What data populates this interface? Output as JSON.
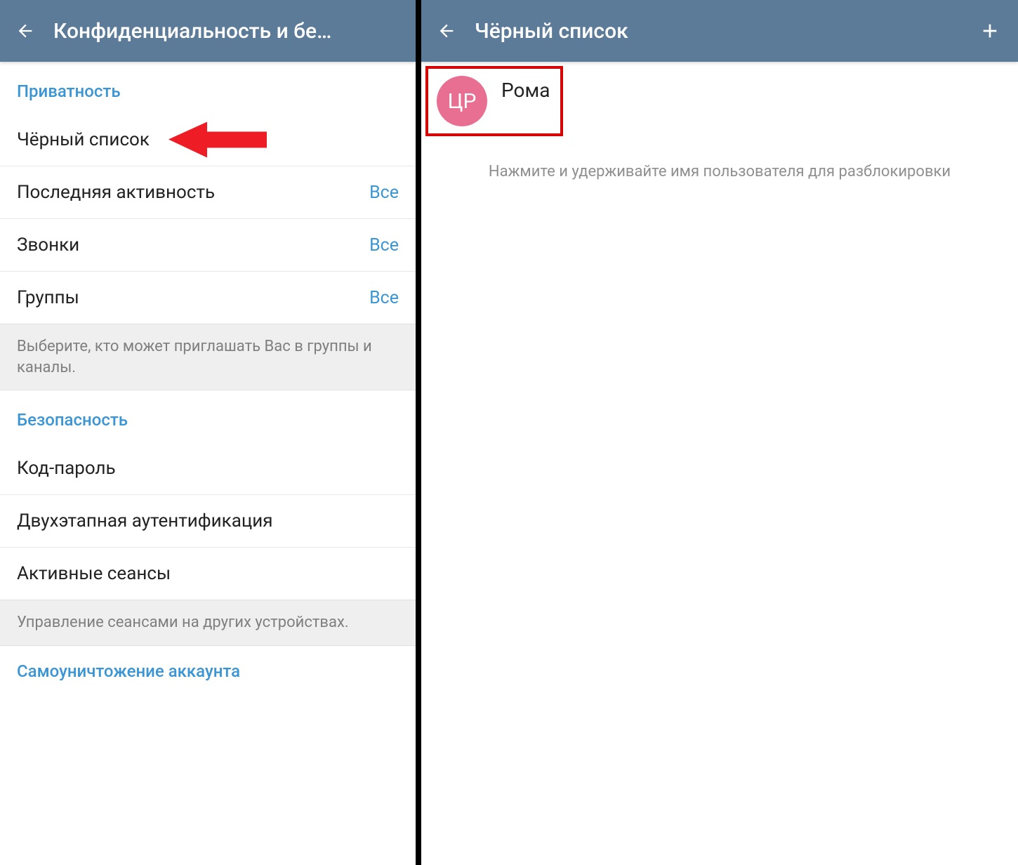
{
  "left": {
    "header_title": "Конфиденциальность и бе…",
    "section_privacy": "Приватность",
    "items_privacy": [
      {
        "label": "Чёрный список",
        "value": ""
      },
      {
        "label": "Последняя активность",
        "value": "Все"
      },
      {
        "label": "Звонки",
        "value": "Все"
      },
      {
        "label": "Группы",
        "value": "Все"
      }
    ],
    "info_privacy": "Выберите, кто может приглашать Вас в группы и каналы.",
    "section_security": "Безопасность",
    "items_security": [
      {
        "label": "Код-пароль",
        "value": ""
      },
      {
        "label": "Двухэтапная аутентификация",
        "value": ""
      },
      {
        "label": "Активные сеансы",
        "value": ""
      }
    ],
    "info_security": "Управление сеансами на других устройствах.",
    "section_account": "Самоуничтожение аккаунта"
  },
  "right": {
    "header_title": "Чёрный список",
    "contact": {
      "initials": "ЦР",
      "name": "Рома"
    },
    "hint": "Нажмите и удерживайте имя пользователя для разблокировки"
  },
  "colors": {
    "header_bg": "#5c7b99",
    "accent": "#3a95d5",
    "arrow": "#ee1c25",
    "avatar_bg": "#e86f92",
    "highlight_border": "#d60000"
  }
}
